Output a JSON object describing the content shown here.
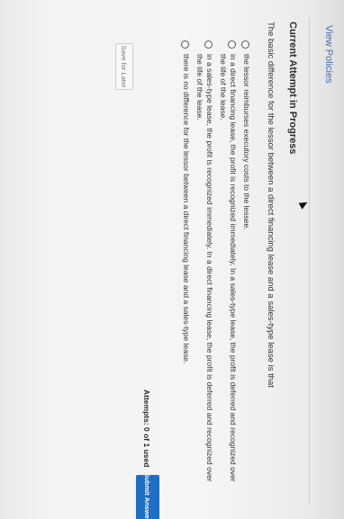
{
  "header": {
    "view_policies": "View Policies"
  },
  "quiz": {
    "title": "Current Attempt in Progress",
    "question": "The basic difference for the lessor between a direct financing lease and a sales-type lease is that",
    "options": [
      "the lessor reimburses executory costs to the lessee.",
      "in a direct financing lease, the profit is recognized immediately. In a sales-type lease, the profit is deferred and recognized over the life of the lease.",
      "in a sales-type lease, the profit is recognized immediately. In a direct financing lease, the profit is deferred and recognized over the life of the lease.",
      "there is no difference for the lessor between a direct financing lease and a sales-type lease."
    ]
  },
  "footer": {
    "save_label": "Save for Later",
    "attempts_label": "Attempts: 0 of 1 used",
    "submit_label": "Submit Answer"
  }
}
